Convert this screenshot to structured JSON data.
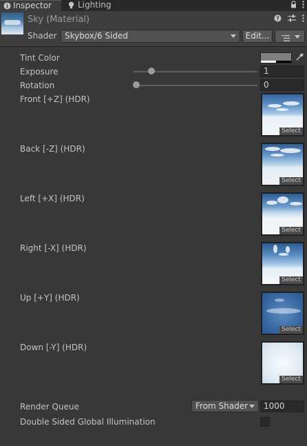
{
  "tabs": [
    {
      "label": "Inspector",
      "icon": "info-icon",
      "active": true
    },
    {
      "label": "Lighting",
      "icon": "lightbulb-icon",
      "active": false
    }
  ],
  "tabbar_icons": [
    "lock-icon",
    "kebab-menu-icon"
  ],
  "header": {
    "title": "Sky (Material)",
    "icons": [
      "help-icon",
      "preset-sliders-icon",
      "kebab-menu-icon"
    ],
    "shader_label": "Shader",
    "shader_value": "Skybox/6 Sided",
    "edit_label": "Edit...",
    "options_icon": "list-icon"
  },
  "properties": {
    "tint_color": {
      "label": "Tint Color",
      "color": "#808080"
    },
    "exposure": {
      "label": "Exposure",
      "value": "1"
    },
    "rotation": {
      "label": "Rotation",
      "value": "0"
    }
  },
  "textures": [
    {
      "label": "Front [+Z]   (HDR)",
      "select": "Select"
    },
    {
      "label": "Back [-Z]   (HDR)",
      "select": "Select"
    },
    {
      "label": "Left [+X]   (HDR)",
      "select": "Select"
    },
    {
      "label": "Right [-X]   (HDR)",
      "select": "Select"
    },
    {
      "label": "Up [+Y]   (HDR)",
      "select": "Select"
    },
    {
      "label": "Down [-Y]   (HDR)",
      "select": "Select"
    }
  ],
  "render_queue": {
    "label": "Render Queue",
    "mode": "From Shader",
    "value": "1000"
  },
  "double_sided_gi": {
    "label": "Double Sided Global Illumination",
    "checked": false
  },
  "colors": {
    "panel": "#383838",
    "tabbar": "#282828",
    "text": "#c4c4c4"
  }
}
